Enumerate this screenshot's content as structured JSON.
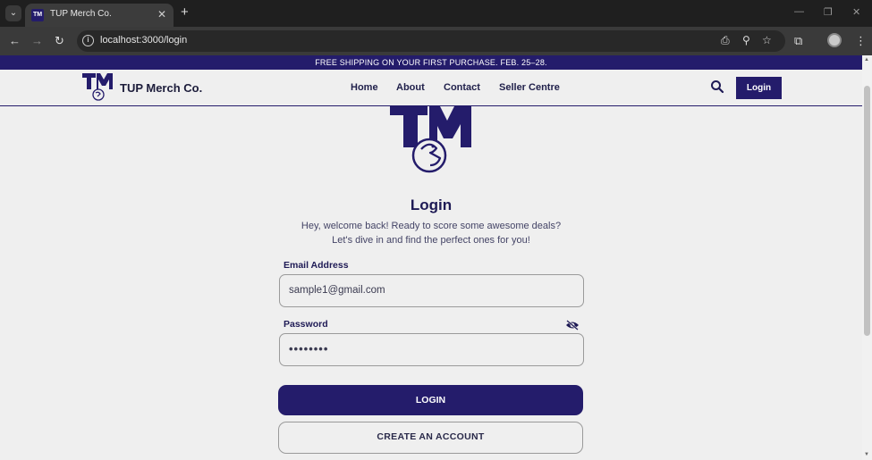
{
  "browser": {
    "tab_title": "TUP Merch Co.",
    "url": "localhost:3000/login",
    "tab_close": "✕",
    "new_tab": "+",
    "minimize": "—",
    "restore": "❐",
    "close_window": "✕"
  },
  "site": {
    "promo": "FREE SHIPPING ON YOUR FIRST PURCHASE. FEB. 25–28.",
    "brand": "TUP Merch Co.",
    "nav": [
      "Home",
      "About",
      "Contact",
      "Seller Centre"
    ],
    "nav_login": "Login"
  },
  "login": {
    "title": "Login",
    "subtitle": "Hey, welcome back! Ready to score some awesome deals? Let's dive in and find the perfect ones for you!",
    "email_label": "Email Address",
    "email_value": "sample1@gmail.com",
    "password_label": "Password",
    "password_value": "••••••••",
    "login_button": "LOGIN",
    "create_button": "CREATE AN ACCOUNT"
  },
  "colors": {
    "brand_navy": "#241c6b",
    "page_bg": "#efefef"
  },
  "icons": {
    "search": "search-icon",
    "eye_off": "eye-off-icon",
    "logo": "tm-logo-icon"
  }
}
